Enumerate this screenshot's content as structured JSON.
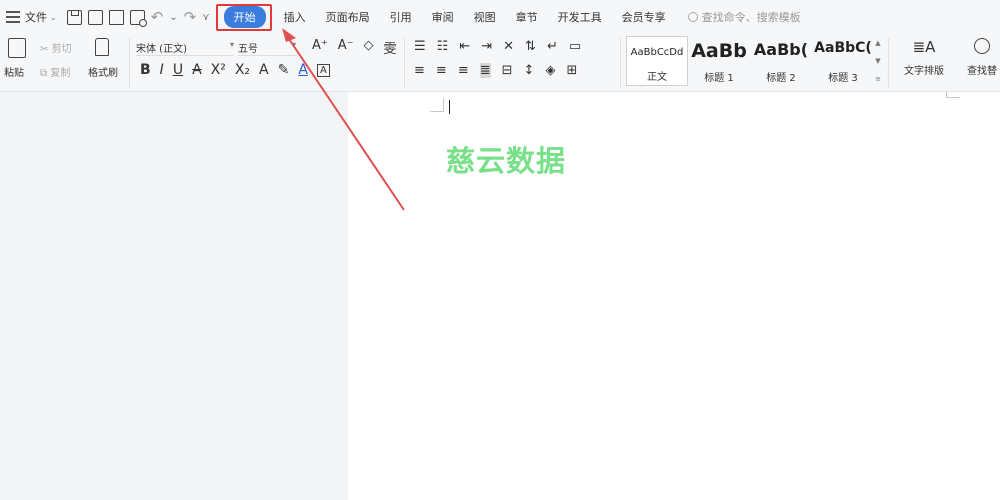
{
  "menu": {
    "file_label": "文件"
  },
  "tabs": [
    {
      "label": "开始",
      "active": true
    },
    {
      "label": "插入"
    },
    {
      "label": "页面布局"
    },
    {
      "label": "引用"
    },
    {
      "label": "审阅"
    },
    {
      "label": "视图"
    },
    {
      "label": "章节"
    },
    {
      "label": "开发工具"
    },
    {
      "label": "会员专享"
    }
  ],
  "search": {
    "placeholder": "查找命令、搜索模板"
  },
  "ribbon": {
    "paste": "粘贴",
    "cut": "剪切",
    "copy": "复制",
    "format_painter": "格式刷",
    "font_name": "宋体 (正文)",
    "font_size": "五号",
    "styles": [
      {
        "preview": "AaBbCcDd",
        "name": "正文"
      },
      {
        "preview": "AaBb",
        "name": "标题 1"
      },
      {
        "preview": "AaBb(",
        "name": "标题 2"
      },
      {
        "preview": "AaBbC(",
        "name": "标题 3"
      }
    ],
    "text_layout": "文字排版",
    "find_replace": "查找替"
  },
  "document": {
    "watermark": "慈云数据"
  },
  "colors": {
    "accent_tab": "#3b7ddd",
    "highlight": "#e03a3a",
    "watermark": "#79e08a"
  }
}
